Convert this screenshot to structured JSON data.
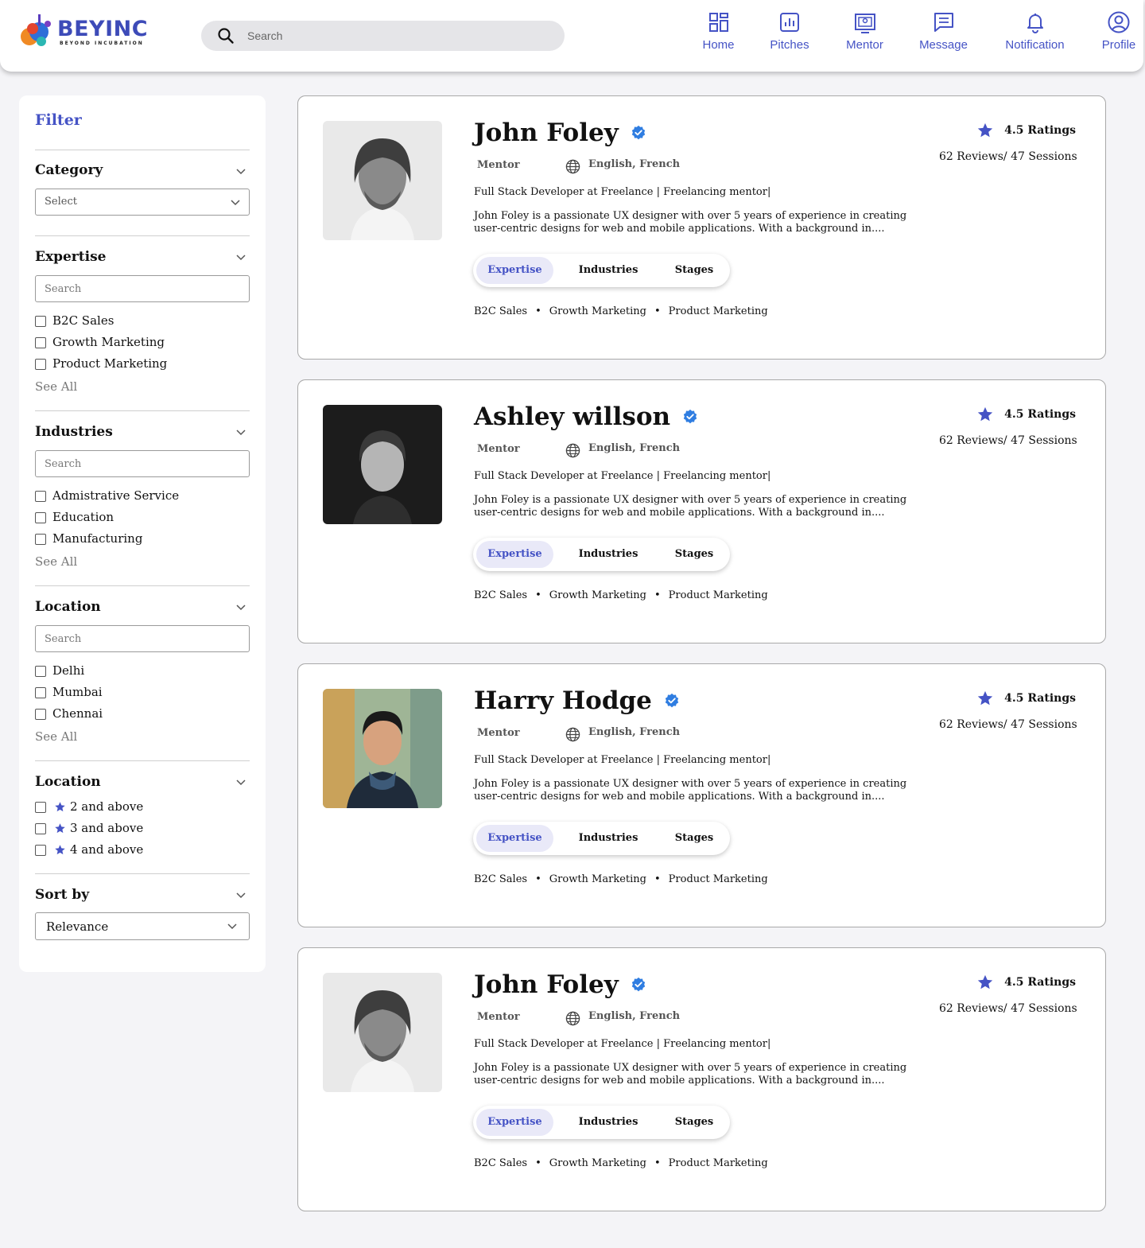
{
  "header": {
    "logo_text": "BEYINC",
    "logo_sub": "BEYOND INCUBATION",
    "search_placeholder": "Search",
    "nav": [
      {
        "label": "Home",
        "icon": "home-icon"
      },
      {
        "label": "Pitches",
        "icon": "pitches-icon"
      },
      {
        "label": "Mentor",
        "icon": "mentor-icon"
      },
      {
        "label": "Message",
        "icon": "message-icon"
      },
      {
        "label": "Notification",
        "icon": "bell-icon"
      },
      {
        "label": "Profile",
        "icon": "profile-icon"
      }
    ]
  },
  "filter": {
    "title": "Filter",
    "category": {
      "title": "Category",
      "select_value": "Select"
    },
    "expertise": {
      "title": "Expertise",
      "search_placeholder": "Search",
      "options": [
        "B2C Sales",
        "Growth Marketing",
        "Product Marketing"
      ],
      "see_all": "See All"
    },
    "industries": {
      "title": "Industries",
      "search_placeholder": "Search",
      "options": [
        "Admistrative Service",
        "Education",
        "Manufacturing"
      ],
      "see_all": "See All"
    },
    "location": {
      "title": "Location",
      "search_placeholder": "Search",
      "options": [
        "Delhi",
        "Mumbai",
        "Chennai"
      ],
      "see_all": "See All"
    },
    "rating": {
      "title": "Location",
      "options": [
        "2 and above",
        "3 and above",
        "4 and above"
      ]
    },
    "sort": {
      "title": "Sort by",
      "value": "Relevance"
    }
  },
  "mentors": [
    {
      "name": "John Foley",
      "role": "Mentor",
      "languages": "English, French",
      "headline": "Full Stack Developer at Freelance  | Freelancing mentor|",
      "bio": "John Foley is a passionate UX designer with over 5 years of experience in creating user-centric designs for web and mobile applications. With a background in....",
      "tabs": [
        "Expertise",
        "Industries",
        "Stages"
      ],
      "active_tab": "Expertise",
      "tags": [
        "B2C Sales",
        "Growth Marketing",
        "Product Marketing"
      ],
      "rating": "4.5 Ratings",
      "reviews": "62 Reviews/ 47 Sessions"
    },
    {
      "name": "Ashley willson",
      "role": "Mentor",
      "languages": "English, French",
      "headline": "Full Stack Developer at Freelance  | Freelancing mentor|",
      "bio": "John Foley is a passionate UX designer with over 5 years of experience in creating user-centric designs for web and mobile applications. With a background in....",
      "tabs": [
        "Expertise",
        "Industries",
        "Stages"
      ],
      "active_tab": "Expertise",
      "tags": [
        "B2C Sales",
        "Growth Marketing",
        "Product Marketing"
      ],
      "rating": "4.5 Ratings",
      "reviews": "62 Reviews/ 47 Sessions"
    },
    {
      "name": "Harry Hodge",
      "role": "Mentor",
      "languages": "English, French",
      "headline": "Full Stack Developer at Freelance  | Freelancing mentor|",
      "bio": "John Foley is a passionate UX designer with over 5 years of experience in creating user-centric designs for web and mobile applications. With a background in....",
      "tabs": [
        "Expertise",
        "Industries",
        "Stages"
      ],
      "active_tab": "Expertise",
      "tags": [
        "B2C Sales",
        "Growth Marketing",
        "Product Marketing"
      ],
      "rating": "4.5 Ratings",
      "reviews": "62 Reviews/ 47 Sessions"
    },
    {
      "name": "John Foley",
      "role": "Mentor",
      "languages": "English, French",
      "headline": "Full Stack Developer at Freelance  | Freelancing mentor|",
      "bio": "John Foley is a passionate UX designer with over 5 years of experience in creating user-centric designs for web and mobile applications. With a background in....",
      "tabs": [
        "Expertise",
        "Industries",
        "Stages"
      ],
      "active_tab": "Expertise",
      "tags": [
        "B2C Sales",
        "Growth Marketing",
        "Product Marketing"
      ],
      "rating": "4.5 Ratings",
      "reviews": "62 Reviews/ 47 Sessions"
    }
  ],
  "colors": {
    "accent": "#4553c5",
    "verified": "#2f7de1",
    "background": "#f4f4f7"
  }
}
